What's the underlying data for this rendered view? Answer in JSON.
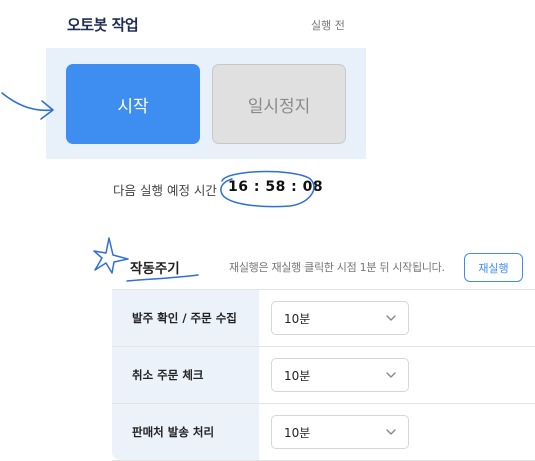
{
  "header": {
    "title": "오토봇 작업",
    "status": "실행 전"
  },
  "controls": {
    "start_label": "시작",
    "pause_label": "일시정지"
  },
  "schedule": {
    "next_run_label": "다음 실행 예정 시간",
    "next_run_time": "16 : 58 : 08"
  },
  "cycle": {
    "title": "작동주기",
    "note": "재실행은 재실행 클릭한 시점 1분 뒤 시작됩니다.",
    "retry_label": "재실행",
    "rows": [
      {
        "label": "발주 확인 / 주문 수집",
        "value": "10분"
      },
      {
        "label": "취소 주문 체크",
        "value": "10분"
      },
      {
        "label": "판매처 발송 처리",
        "value": "10분"
      }
    ]
  },
  "colors": {
    "accent": "#3d8ef0",
    "panel_bg": "#e8f1fa",
    "title": "#1d2c52"
  }
}
